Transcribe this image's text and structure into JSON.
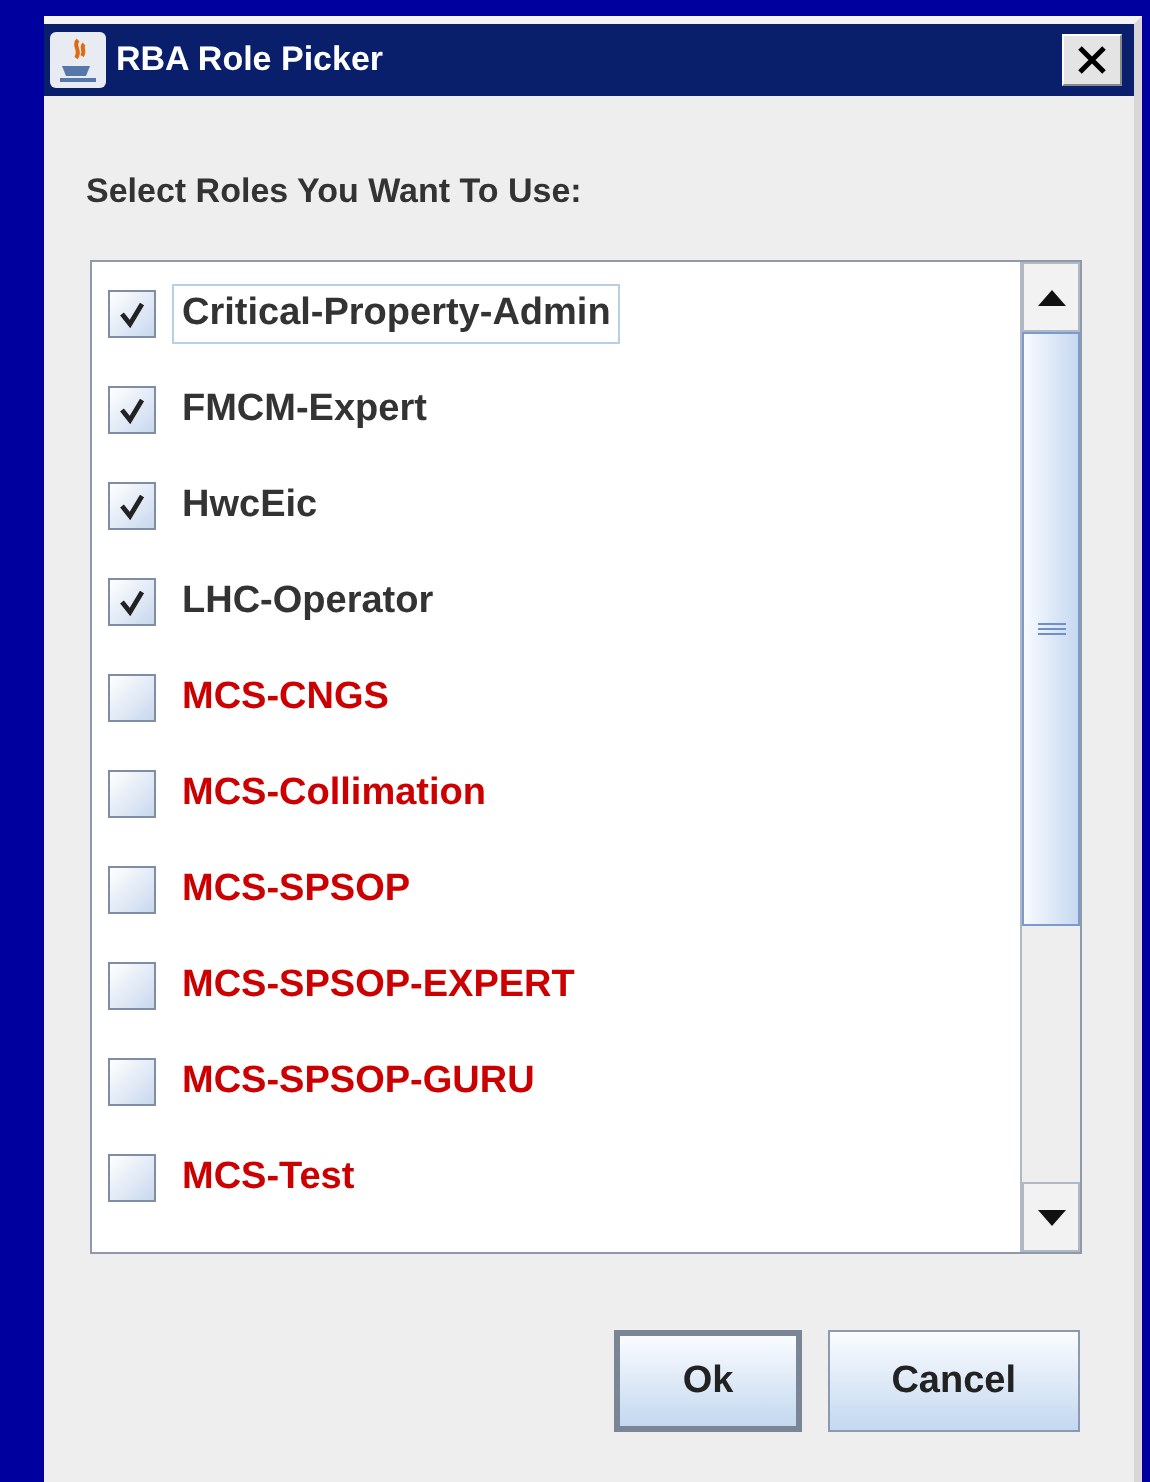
{
  "window": {
    "title": "RBA Role Picker"
  },
  "heading": "Select Roles You Want To Use:",
  "roles": [
    {
      "label": "Critical-Property-Admin",
      "checked": true,
      "focused": true,
      "color": "#333333"
    },
    {
      "label": "FMCM-Expert",
      "checked": true,
      "focused": false,
      "color": "#333333"
    },
    {
      "label": "HwcEic",
      "checked": true,
      "focused": false,
      "color": "#333333"
    },
    {
      "label": "LHC-Operator",
      "checked": true,
      "focused": false,
      "color": "#333333"
    },
    {
      "label": "MCS-CNGS",
      "checked": false,
      "focused": false,
      "color": "#cc0000"
    },
    {
      "label": "MCS-Collimation",
      "checked": false,
      "focused": false,
      "color": "#cc0000"
    },
    {
      "label": "MCS-SPSOP",
      "checked": false,
      "focused": false,
      "color": "#cc0000"
    },
    {
      "label": "MCS-SPSOP-EXPERT",
      "checked": false,
      "focused": false,
      "color": "#cc0000"
    },
    {
      "label": "MCS-SPSOP-GURU",
      "checked": false,
      "focused": false,
      "color": "#cc0000"
    },
    {
      "label": "MCS-Test",
      "checked": false,
      "focused": false,
      "color": "#cc0000"
    }
  ],
  "buttons": [
    {
      "label": "Ok",
      "default": true
    },
    {
      "label": "Cancel",
      "default": false
    }
  ]
}
